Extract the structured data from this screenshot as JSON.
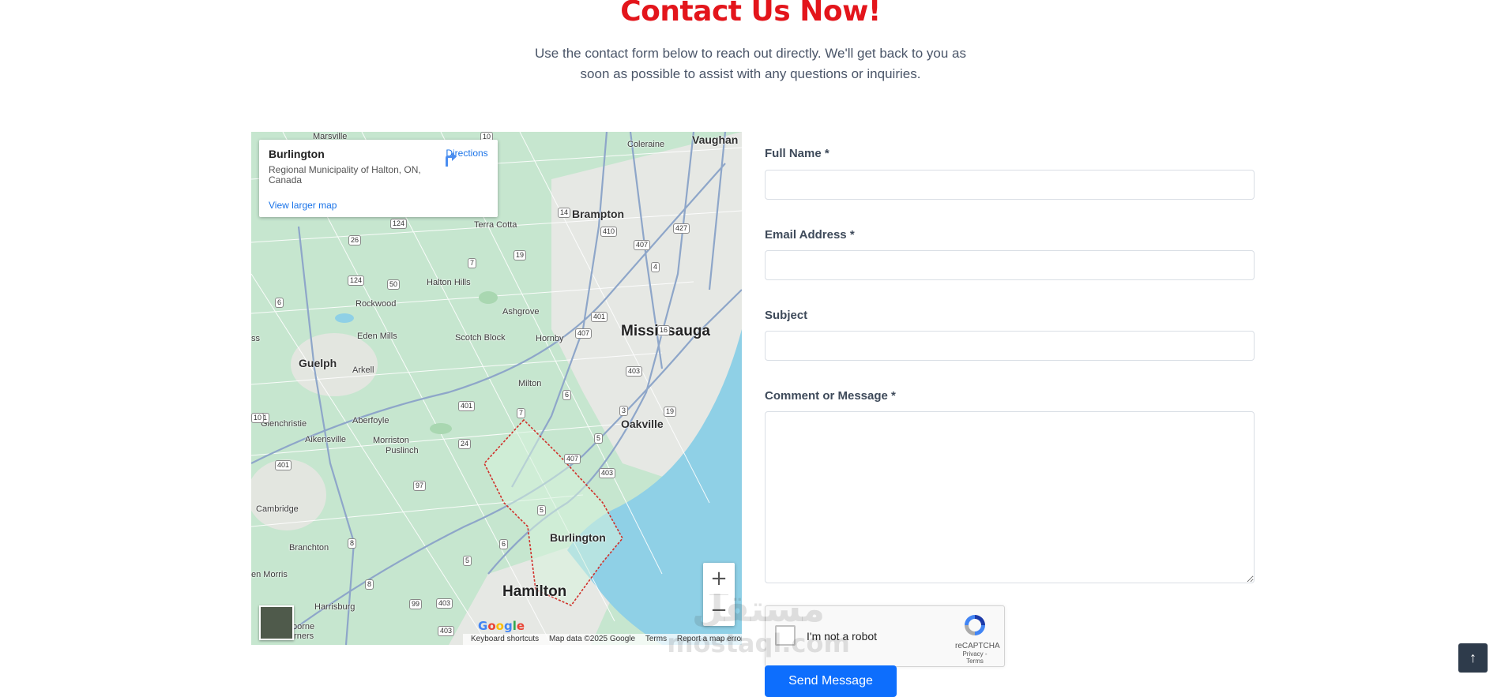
{
  "header": {
    "title": "Contact Us Now!",
    "subtitle": "Use the contact form below to reach out directly. We'll get back to you as soon as possible to assist with any questions or inquiries."
  },
  "map": {
    "info_card": {
      "place": "Burlington",
      "address": "Regional Municipality of Halton, ON, Canada",
      "directions_label": "Directions",
      "larger_map_label": "View larger map"
    },
    "city_labels": {
      "marsville": "Marsville",
      "coleraine": "Coleraine",
      "vaughan": "Vaughan",
      "brampton": "Brampton",
      "terra_cotta": "Terra Cotta",
      "halton_hills": "Halton Hills",
      "rockwood": "Rockwood",
      "ashgrove": "Ashgrove",
      "eden_mills": "Eden Mills",
      "mississauga": "Mississauga",
      "scotch_block": "Scotch Block",
      "hornby": "Hornby",
      "guelph": "Guelph",
      "arkell": "Arkell",
      "milton": "Milton",
      "glenchristie": "Glenchristie",
      "aberfoyle": "Aberfoyle",
      "oakville": "Oakville",
      "aikensville": "Aikensville",
      "morriston": "Morriston",
      "puslinch": "Puslinch",
      "cambridge": "Cambridge",
      "burlington": "Burlington",
      "branchton": "Branchton",
      "morris": "en Morris",
      "hamilton": "Hamilton",
      "harrisburg": "Harrisburg",
      "borne": "borne",
      "corners": "Corners",
      "ss": "ss"
    },
    "highway_shields": [
      "10",
      "14",
      "410",
      "427",
      "124",
      "26",
      "19",
      "7",
      "407",
      "124",
      "50",
      "4",
      "6",
      "401",
      "407",
      "16",
      "401",
      "6",
      "403",
      "3",
      "19",
      "401",
      "7",
      "24",
      "5",
      "401",
      "407",
      "403",
      "97",
      "5",
      "6",
      "8",
      "5",
      "403",
      "8",
      "99",
      "403",
      "10"
    ],
    "attribution": {
      "logo": "Google",
      "keyboard": "Keyboard shortcuts",
      "data": "Map data ©2025 Google",
      "terms": "Terms",
      "report": "Report a map error"
    },
    "zoom_in": "+",
    "zoom_out": "−"
  },
  "form": {
    "full_name": {
      "label": "Full Name",
      "required_mark": "*",
      "value": "",
      "placeholder": ""
    },
    "email": {
      "label": "Email Address",
      "required_mark": "*",
      "value": "",
      "placeholder": ""
    },
    "subject": {
      "label": "Subject",
      "value": "",
      "placeholder": ""
    },
    "message": {
      "label": "Comment or Message",
      "required_mark": "*",
      "value": "",
      "placeholder": ""
    },
    "captcha": {
      "text": "I'm not a robot",
      "brand": "reCAPTCHA",
      "links": "Privacy - Terms"
    },
    "submit_label": "Send Message"
  },
  "watermark": {
    "arabic": "مستقل",
    "latin": "mostaql.com"
  },
  "back_to_top": "↑",
  "colors": {
    "title": "#e3151b",
    "submit": "#0d6efd",
    "water": "#8fd0e6",
    "land": "#c6e6cf"
  }
}
